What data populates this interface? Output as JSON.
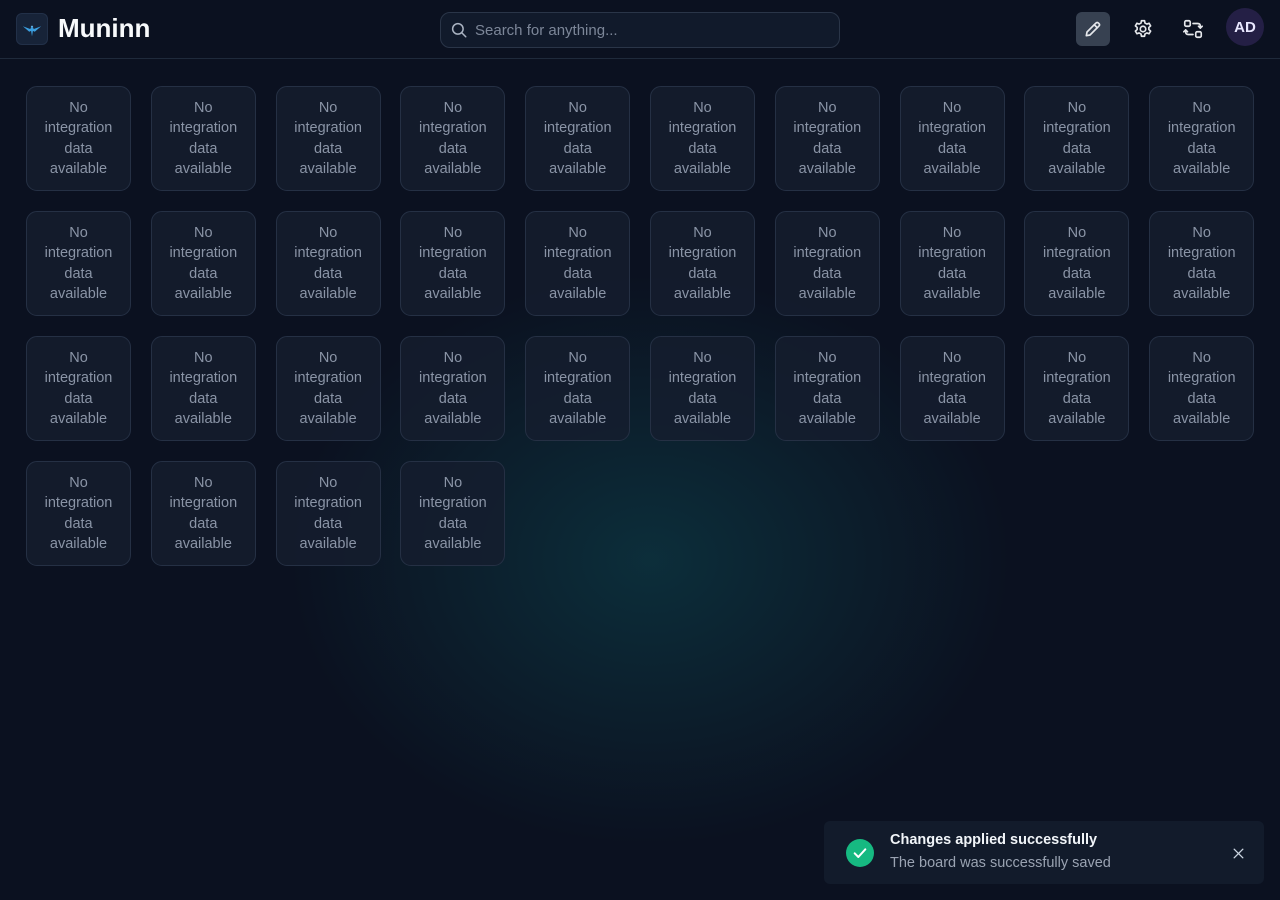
{
  "app": {
    "title": "Muninn",
    "logo_icon": "raven-icon"
  },
  "header": {
    "search": {
      "placeholder": "Search for anything...",
      "value": ""
    },
    "actions": [
      {
        "name": "edit-board-button",
        "icon": "pencil-icon",
        "active": true
      },
      {
        "name": "settings-button",
        "icon": "gear-icon"
      },
      {
        "name": "swap-board-button",
        "icon": "arrows-swap-icon"
      }
    ],
    "avatar_initials": "AD"
  },
  "board": {
    "columns": 10,
    "tiles": [
      "No integration data available",
      "No integration data available",
      "No integration data available",
      "No integration data available",
      "No integration data available",
      "No integration data available",
      "No integration data available",
      "No integration data available",
      "No integration data available",
      "No integration data available",
      "No integration data available",
      "No integration data available",
      "No integration data available",
      "No integration data available",
      "No integration data available",
      "No integration data available",
      "No integration data available",
      "No integration data available",
      "No integration data available",
      "No integration data available",
      "No integration data available",
      "No integration data available",
      "No integration data available",
      "No integration data available",
      "No integration data available",
      "No integration data available",
      "No integration data available",
      "No integration data available",
      "No integration data available",
      "No integration data available",
      "No integration data available",
      "No integration data available",
      "No integration data available",
      "No integration data available"
    ]
  },
  "toast": {
    "title": "Changes applied successfully",
    "message": "The board was successfully saved",
    "status": "success",
    "status_icon": "check-icon",
    "close_icon": "close-icon"
  },
  "colors": {
    "background": "#0b1120",
    "accent_success": "#16b981",
    "avatar_bg": "#241f45",
    "tile_border": "#253044"
  }
}
